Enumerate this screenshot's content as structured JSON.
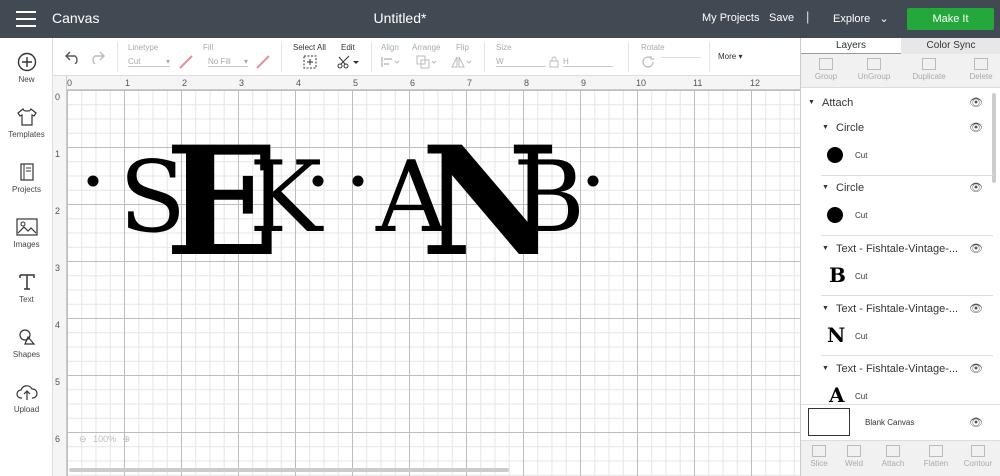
{
  "header": {
    "app_title": "Canvas",
    "doc_title": "Untitled*",
    "my_projects": "My Projects",
    "save": "Save",
    "separator": "|",
    "explore": "Explore",
    "make_it": "Make It"
  },
  "left_tools": [
    {
      "label": "New",
      "icon": "plus-circle-icon"
    },
    {
      "label": "Templates",
      "icon": "tshirt-icon"
    },
    {
      "label": "Projects",
      "icon": "notebook-icon"
    },
    {
      "label": "Images",
      "icon": "image-icon"
    },
    {
      "label": "Text",
      "icon": "text-icon"
    },
    {
      "label": "Shapes",
      "icon": "shapes-icon"
    },
    {
      "label": "Upload",
      "icon": "cloud-upload-icon"
    }
  ],
  "edit_toolbar": {
    "linetype_label": "Linetype",
    "linetype_value": "Cut",
    "fill_label": "Fill",
    "fill_value": "No Fill",
    "select_all": "Select All",
    "edit": "Edit",
    "align": "Align",
    "arrange": "Arrange",
    "flip": "Flip",
    "size": "Size",
    "size_w": "W",
    "size_h": "H",
    "rotate": "Rotate",
    "more": "More"
  },
  "canvas": {
    "ruler_top": [
      "0",
      "1",
      "2",
      "3",
      "4",
      "5",
      "6",
      "7",
      "8",
      "9",
      "10",
      "11",
      "12"
    ],
    "ruler_left": [
      "0",
      "1",
      "2",
      "3",
      "4",
      "5",
      "6"
    ],
    "zoom": "100%",
    "monogram_left": {
      "small1": "S",
      "big": "E",
      "small2": "K"
    },
    "monogram_right": {
      "small1": "A",
      "big": "N",
      "small2": "B"
    }
  },
  "right_panel": {
    "tabs": [
      "Layers",
      "Color Sync"
    ],
    "actions": [
      "Group",
      "UnGroup",
      "Duplicate",
      "Delete"
    ],
    "attach_label": "Attach",
    "layers": [
      {
        "name": "Circle",
        "op": "Cut"
      },
      {
        "name": "Circle",
        "op": "Cut"
      },
      {
        "name": "Text - Fishtale-Vintage-...",
        "op": "Cut",
        "letter": "B"
      },
      {
        "name": "Text - Fishtale-Vintage-...",
        "op": "Cut",
        "letter": "N"
      },
      {
        "name": "Text - Fishtale-Vintage-...",
        "op": "Cut",
        "letter": "A"
      }
    ],
    "blank_canvas": "Blank Canvas",
    "bottom_actions": [
      "Slice",
      "Weld",
      "Attach",
      "Flatten",
      "Contour"
    ]
  }
}
